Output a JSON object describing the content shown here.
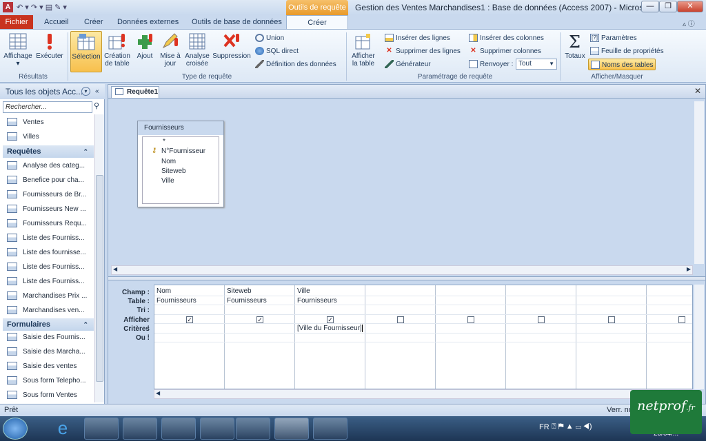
{
  "window": {
    "title": "Gestion des Ventes Marchandises1 : Base de données (Access 2007) - Microsoft Acc...",
    "context_label": "Outils de requête",
    "buttons": {
      "minimize": "—",
      "maximize": "❐",
      "close": "✕"
    }
  },
  "tabs": [
    "Fichier",
    "Accueil",
    "Créer",
    "Données externes",
    "Outils de base de données",
    "Créer"
  ],
  "ribbon": {
    "resultats": {
      "label": "Résultats",
      "affichage": "Affichage",
      "executer": "Exécuter"
    },
    "type_requete": {
      "label": "Type de requête",
      "selection": "Sélection",
      "creation_table": "Création de table",
      "ajout": "Ajout",
      "mise_a_jour": "Mise à jour",
      "analyse_croisee": "Analyse croisée",
      "suppression": "Suppression",
      "union": "Union",
      "sql_direct": "SQL direct",
      "definition_donnees": "Définition des données"
    },
    "parametrage": {
      "label": "Paramétrage de requête",
      "afficher_table": "Afficher la table",
      "inserer_lignes": "Insérer des lignes",
      "supprimer_lignes": "Supprimer des lignes",
      "generateur": "Générateur",
      "inserer_colonnes": "Insérer des colonnes",
      "supprimer_colonnes": "Supprimer colonnes",
      "renvoyer": "Renvoyer :",
      "renvoyer_value": "Tout"
    },
    "afficher_masquer": {
      "label": "Afficher/Masquer",
      "totaux": "Totaux",
      "parametres": "Paramètres",
      "feuille_proprietes": "Feuille de propriétés",
      "noms_tables": "Noms des tables"
    }
  },
  "nav": {
    "header": "Tous les objets Acc...",
    "search_placeholder": "Rechercher...",
    "tables": [
      "Ventes",
      "Villes"
    ],
    "sections": {
      "requetes": "Requêtes",
      "formulaires": "Formulaires"
    },
    "requetes": [
      "Analyse des categ...",
      "Benefice pour cha...",
      "Fournisseurs de Br...",
      "Fournisseurs New ...",
      "Fournisseurs Requ...",
      "Liste des Fourniss...",
      "Liste des fournisse...",
      "Liste des Fourniss...",
      "Liste des Fourniss...",
      "Marchandises Prix ...",
      "Marchandises ven..."
    ],
    "formulaires": [
      "Saisie des Fournis...",
      "Saisie des Marcha...",
      "Saisie des ventes",
      "Sous form Telepho...",
      "Sous form Ventes"
    ]
  },
  "document": {
    "tab_label": "Requête1",
    "field_list": {
      "title": "Fournisseurs",
      "fields": [
        "*",
        "N°Fournisseur",
        "Nom",
        "Siteweb",
        "Ville"
      ]
    },
    "grid": {
      "row_labels": [
        "Champ :",
        "Table :",
        "Tri :",
        "Afficher :",
        "Critères :",
        "Ou :"
      ],
      "columns": [
        {
          "champ": "Nom",
          "table": "Fournisseurs",
          "afficher": true,
          "criteres": ""
        },
        {
          "champ": "Siteweb",
          "table": "Fournisseurs",
          "afficher": true,
          "criteres": ""
        },
        {
          "champ": "Ville",
          "table": "Fournisseurs",
          "afficher": true,
          "criteres": "[Ville du Fournisseur]"
        },
        {
          "champ": "",
          "table": "",
          "afficher": false,
          "criteres": ""
        },
        {
          "champ": "",
          "table": "",
          "afficher": false,
          "criteres": ""
        },
        {
          "champ": "",
          "table": "",
          "afficher": false,
          "criteres": ""
        },
        {
          "champ": "",
          "table": "",
          "afficher": false,
          "criteres": ""
        },
        {
          "champ": "",
          "table": "",
          "afficher": false,
          "criteres": ""
        }
      ]
    }
  },
  "status": {
    "left": "Prêt",
    "right": "Verr. nu"
  },
  "tray": {
    "lang": "FR",
    "date": "23/04/..."
  },
  "watermark": "netprof"
}
